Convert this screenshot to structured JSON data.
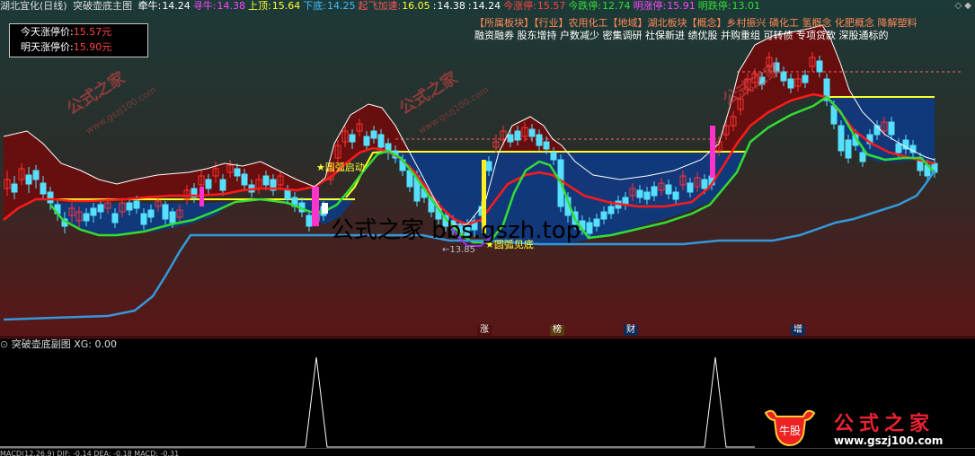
{
  "header": {
    "stock": "湖北宜化(日线)",
    "indicator": "突破壶底主图",
    "fields": [
      {
        "label": "牵牛:",
        "value": "14.24",
        "color": "#ffffff",
        "labelColor": "#ffffff"
      },
      {
        "label": "寻牛:",
        "value": "14.38",
        "color": "#ff44ff",
        "labelColor": "#ff44ff"
      },
      {
        "label": "上顶:",
        "value": "15.64",
        "color": "#ffff33",
        "labelColor": "#ffff33"
      },
      {
        "label": "下底:",
        "value": "14.25",
        "color": "#44bbff",
        "labelColor": "#44bbff"
      },
      {
        "label": "起飞加速:",
        "value": "16.05",
        "color": "#ffff33",
        "labelColor": "#ff5555"
      },
      {
        "label": ":",
        "value": "14.38",
        "color": "#ffffff",
        "labelColor": "#ffffff"
      },
      {
        "label": ":",
        "value": "14.24",
        "color": "#ffffff",
        "labelColor": "#ffffff"
      },
      {
        "label": "今涨停:",
        "value": "15.57",
        "color": "#ff4444",
        "labelColor": "#ff4444"
      },
      {
        "label": "今跌停:",
        "value": "12.74",
        "color": "#33dd33",
        "labelColor": "#33dd33"
      },
      {
        "label": "明涨停:",
        "value": "15.91",
        "color": "#ff44ff",
        "labelColor": "#ff44ff"
      },
      {
        "label": "明跌停:",
        "value": "13.01",
        "color": "#33dd33",
        "labelColor": "#33dd33"
      }
    ]
  },
  "limit_box": {
    "today_label": "今天涨停价:",
    "today_value": "15.57元",
    "tomorrow_label": "明天涨停价:",
    "tomorrow_value": "15.90元"
  },
  "sector": {
    "row1": "【所属板块】【行业】农用化工【地域】湖北板块【概念】乡村振兴 磷化工 氢概念 化肥概念 降解塑料",
    "row2": "融资融券 股东增持 户数减少 密集调研 社保新进 绩优股 并购重组 可转债 专项贷款 深股通标的"
  },
  "annotations": {
    "arc_start": "★圆弧启动",
    "arc_seen": "★圆弧见底",
    "low_price": "←13.85"
  },
  "center_watermark": "公式之家 bbs.gszh.top",
  "badges": [
    {
      "text": "涨",
      "bg": "#4a1010",
      "color": "#ffffff"
    },
    {
      "text": "榜",
      "bg": "#5a3a10",
      "color": "#ffffff"
    },
    {
      "text": "财",
      "bg": "#102a55",
      "color": "#ffffff"
    },
    {
      "text": "增",
      "bg": "#102a55",
      "color": "#ffffff"
    }
  ],
  "sub": {
    "title": "突破壶底副图",
    "xg_label": "XG: 0.00",
    "bottom_text": "MACD(12,26,9) DIF: -0.14 DEA: -0.18 MACD: -0.31"
  },
  "logo": {
    "title": "公式之家",
    "url": "www.gszj100.com",
    "mark": "牛股"
  },
  "watermarks": {
    "big": "公式之家",
    "small": "www.gszj100.com"
  },
  "colors": {
    "rise": "#ff3333",
    "fall": "#55e0ff",
    "red_line": "#ff1a1a",
    "green_line": "#33dd33",
    "blue_line": "#3399dd",
    "yellow": "#ffff22",
    "magenta": "#ff33cc",
    "fill_top": "#6a0d0d",
    "fill_bottom": "#0f3a80"
  },
  "chart_data": {
    "type": "candlestick",
    "title": "湖北宜化(日线)",
    "ohlc_approx": {
      "highest_visible": 16.05,
      "lowest_marked": 13.85
    }
  }
}
